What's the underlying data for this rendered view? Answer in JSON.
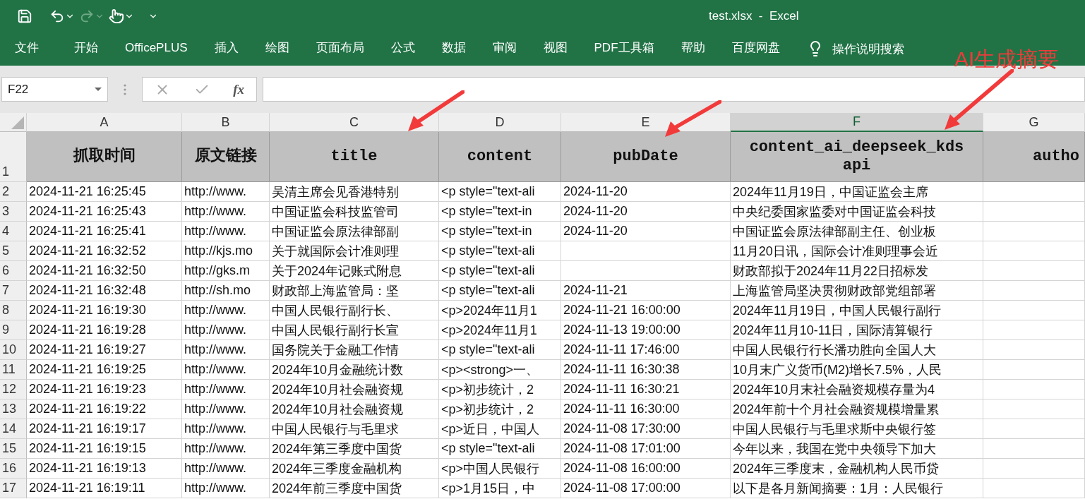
{
  "title_bar": {
    "title": "test.xlsx  -  Excel",
    "redo": {
      "disabled": true
    }
  },
  "ribbon_tabs": [
    {
      "label": "文件",
      "selected": false
    },
    {
      "label": "开始",
      "selected": false
    },
    {
      "label": "OfficePLUS",
      "selected": false
    },
    {
      "label": "插入",
      "selected": false
    },
    {
      "label": "绘图",
      "selected": false
    },
    {
      "label": "页面布局",
      "selected": false
    },
    {
      "label": "公式",
      "selected": false
    },
    {
      "label": "数据",
      "selected": false
    },
    {
      "label": "审阅",
      "selected": false
    },
    {
      "label": "视图",
      "selected": false
    },
    {
      "label": "PDF工具箱",
      "selected": false
    },
    {
      "label": "帮助",
      "selected": false
    },
    {
      "label": "百度网盘",
      "selected": false
    }
  ],
  "tell_me": "操作说明搜索",
  "annotation": {
    "text": "AI生成摘要"
  },
  "formula_bar": {
    "name_box": "F22",
    "function_label": "fx"
  },
  "columns": [
    {
      "letter": "A",
      "selected": false
    },
    {
      "letter": "B",
      "selected": false
    },
    {
      "letter": "C",
      "selected": false
    },
    {
      "letter": "D",
      "selected": false
    },
    {
      "letter": "E",
      "selected": false
    },
    {
      "letter": "F",
      "selected": true
    },
    {
      "letter": "G",
      "selected": false
    }
  ],
  "header_row": {
    "number": "1",
    "cells": [
      "抓取时间",
      "原文链接",
      "title",
      "content",
      "pubDate",
      "content_ai_deepseek_kds api",
      "autho"
    ]
  },
  "rows": [
    {
      "number": "2",
      "a": "2024-11-21 16:25:45",
      "b": "http://www.",
      "c": "吴清主席会见香港特别",
      "d": "<p style=\"text-ali",
      "e": "2024-11-20",
      "f": "2024年11月19日，中国证监会主席"
    },
    {
      "number": "3",
      "a": "2024-11-21 16:25:43",
      "b": "http://www.",
      "c": "中国证监会科技监管司",
      "d": "<p style=\"text-in",
      "e": "2024-11-20",
      "f": "中央纪委国家监委对中国证监会科技"
    },
    {
      "number": "4",
      "a": "2024-11-21 16:25:41",
      "b": "http://www.",
      "c": "中国证监会原法律部副",
      "d": "<p style=\"text-in",
      "e": "2024-11-20",
      "f": "中国证监会原法律部副主任、创业板"
    },
    {
      "number": "5",
      "a": "2024-11-21 16:32:52",
      "b": "http://kjs.mo",
      "c": "关于就国际会计准则理",
      "d": "<p style=\"text-ali",
      "f": "11月20日讯，国际会计准则理事会近"
    },
    {
      "number": "6",
      "a": "2024-11-21 16:32:50",
      "b": "http://gks.m",
      "c": "关于2024年记账式附息",
      "d": "<p style=\"text-ali",
      "f": "财政部拟于2024年11月22日招标发"
    },
    {
      "number": "7",
      "a": "2024-11-21 16:32:48",
      "b": "http://sh.mo",
      "c": "财政部上海监管局：坚",
      "d": "<p style=\"text-ali",
      "e": "2024-11-21",
      "f": "上海监管局坚决贯彻财政部党组部署"
    },
    {
      "number": "8",
      "a": "2024-11-21 16:19:30",
      "b": "http://www.",
      "c": "中国人民银行副行长、",
      "d": "<p>2024年11月1",
      "e": "2024-11-21 16:00:00",
      "f": "2024年11月19日，中国人民银行副行"
    },
    {
      "number": "9",
      "a": "2024-11-21 16:19:28",
      "b": "http://www.",
      "c": "中国人民银行副行长宣",
      "d": "<p>2024年11月1",
      "e": "2024-11-13 19:00:00",
      "f": "2024年11月10-11日，国际清算银行"
    },
    {
      "number": "10",
      "a": "2024-11-21 16:19:27",
      "b": "http://www.",
      "c": "国务院关于金融工作情",
      "d": "<p style=\"text-ali",
      "e": "2024-11-11 17:46:00",
      "f": "中国人民银行行长潘功胜向全国人大"
    },
    {
      "number": "11",
      "a": "2024-11-21 16:19:25",
      "b": "http://www.",
      "c": "2024年10月金融统计数",
      "d": "<p><strong>一、",
      "e": "2024-11-11 16:30:38",
      "f": "10月末广义货币(M2)增长7.5%，人民"
    },
    {
      "number": "12",
      "a": "2024-11-21 16:19:23",
      "b": "http://www.",
      "c": "2024年10月社会融资规",
      "d": "<p>初步统计，2",
      "e": "2024-11-11 16:30:21",
      "f": "2024年10月末社会融资规模存量为4"
    },
    {
      "number": "13",
      "a": "2024-11-21 16:19:22",
      "b": "http://www.",
      "c": "2024年10月社会融资规",
      "d": "<p>初步统计，2",
      "e": "2024-11-11 16:30:00",
      "f": "2024年前十个月社会融资规模增量累"
    },
    {
      "number": "14",
      "a": "2024-11-21 16:19:17",
      "b": "http://www.",
      "c": "中国人民银行与毛里求",
      "d": "<p>近日，中国人",
      "e": "2024-11-08 17:30:00",
      "f": "中国人民银行与毛里求斯中央银行签"
    },
    {
      "number": "15",
      "a": "2024-11-21 16:19:15",
      "b": "http://www.",
      "c": "2024年第三季度中国货",
      "d": "<p style=\"text-ali",
      "e": "2024-11-08 17:01:00",
      "f": "今年以来，我国在党中央领导下加大"
    },
    {
      "number": "16",
      "a": "2024-11-21 16:19:13",
      "b": "http://www.",
      "c": "2024年三季度金融机构",
      "d": "<p>中国人民银行",
      "e": "2024-11-08 16:00:00",
      "f": "2024年三季度末，金融机构人民币贷"
    },
    {
      "number": "17",
      "a": "2024-11-21 16:19:11",
      "b": "http://www.",
      "c": "2024年前三季度中国货",
      "d": "<p>1月15日，中",
      "e": "2024-11-08 17:00:00",
      "f": "以下是各月新闻摘要：1月：人民银行"
    }
  ]
}
